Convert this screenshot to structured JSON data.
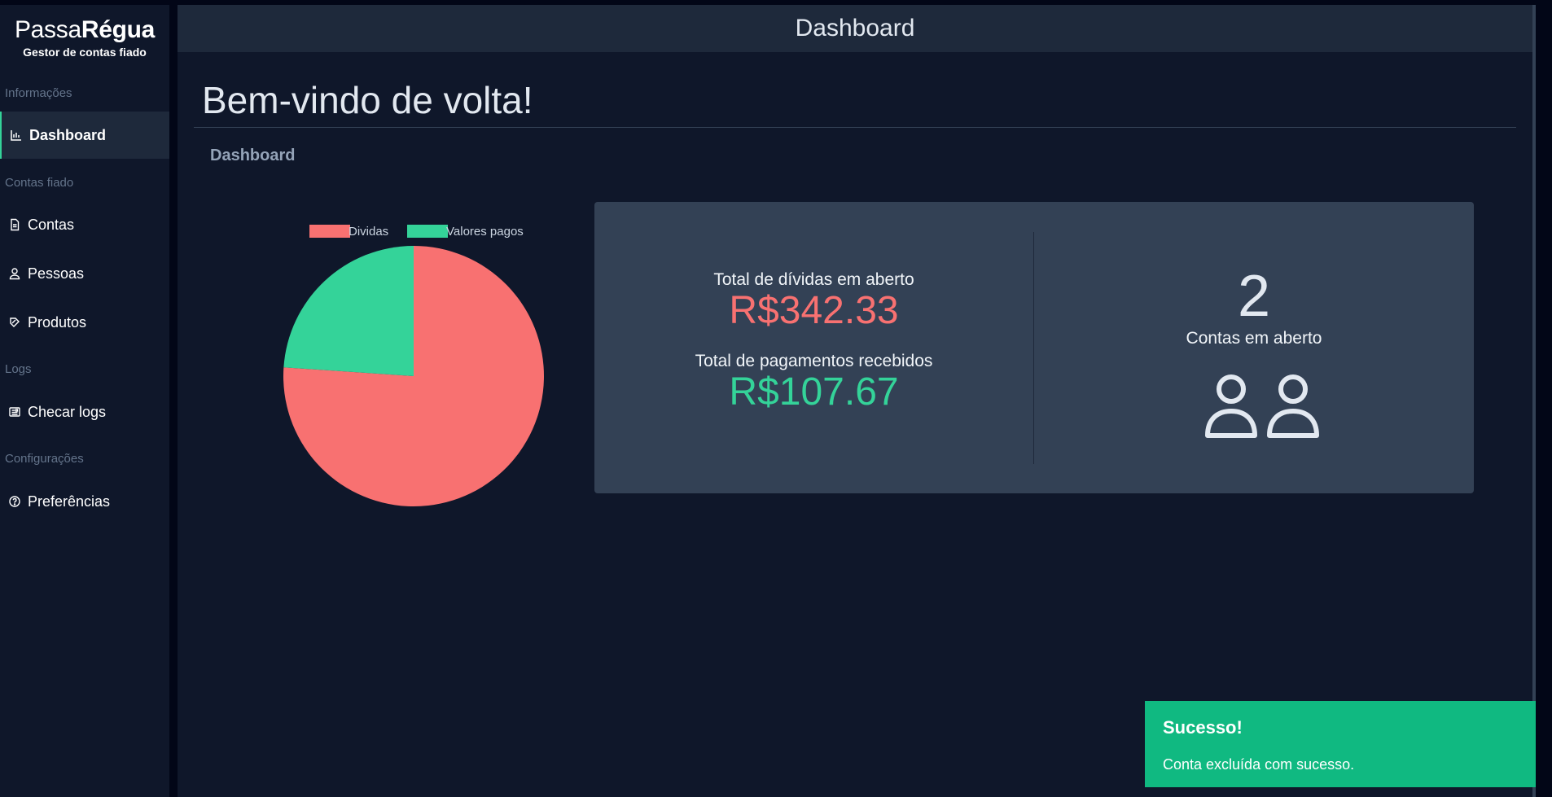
{
  "sidebar": {
    "brand_light": "Passa",
    "brand_bold": "Régua",
    "brand_sub": "Gestor de contas fiado",
    "sections": [
      {
        "label": "Informações"
      },
      {
        "label": "Contas fiado"
      },
      {
        "label": "Logs"
      },
      {
        "label": "Configurações"
      }
    ],
    "items": [
      {
        "label": "Dashboard",
        "icon": "chart-icon",
        "active": true
      },
      {
        "label": "Contas",
        "icon": "document-icon"
      },
      {
        "label": "Pessoas",
        "icon": "user-icon"
      },
      {
        "label": "Produtos",
        "icon": "tag-icon"
      },
      {
        "label": "Checar logs",
        "icon": "newspaper-icon"
      },
      {
        "label": "Preferências",
        "icon": "help-circle-icon"
      }
    ]
  },
  "header": {
    "title": "Dashboard"
  },
  "main": {
    "welcome": "Bem-vindo de volta!",
    "subhead": "Dashboard"
  },
  "chart_data": {
    "type": "pie",
    "categories": [
      "Dividas",
      "Valores pagos"
    ],
    "values": [
      342.33,
      107.67
    ],
    "colors": [
      "#f87171",
      "#34d399"
    ],
    "legend": "top"
  },
  "stats": {
    "debt_label": "Total de dívidas em aberto",
    "debt_value": "R$342.33",
    "paid_label": "Total de pagamentos recebidos",
    "paid_value": "R$107.67",
    "open_count": "2",
    "open_label": "Contas em aberto",
    "debt_color": "#f87171",
    "paid_color": "#34d399"
  },
  "toast": {
    "title": "Sucesso!",
    "message": "Conta excluída com sucesso.",
    "color": "#10b981"
  }
}
